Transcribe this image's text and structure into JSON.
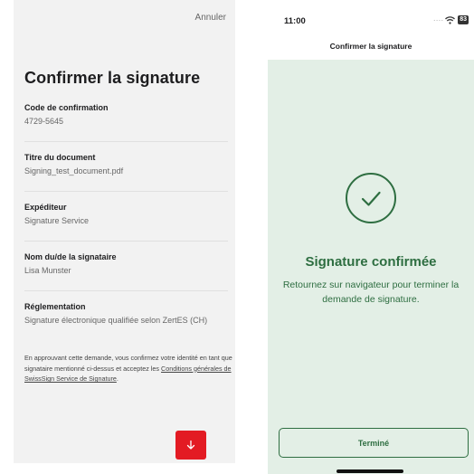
{
  "left": {
    "cancel_label": "Annuler",
    "title": "Confirmer la signature",
    "fields": [
      {
        "label": "Code de confirmation",
        "value": "4729-5645"
      },
      {
        "label": "Titre du document",
        "value": "Signing_test_document.pdf"
      },
      {
        "label": "Expéditeur",
        "value": "Signature Service"
      },
      {
        "label": "Nom du/de la signataire",
        "value": "Lisa Munster"
      },
      {
        "label": "Réglementation",
        "value": "Signature électronique qualifiée selon ZertES (CH)"
      }
    ],
    "consent_text": "En approuvant cette demande, vous confirmez votre identité en tant que signataire mentionné ci-dessus et acceptez les ",
    "consent_link": "Conditions générales de SwissSign Service de Signature",
    "consent_end": ".",
    "next_button_icon": "arrow-down-icon",
    "accent_color": "#e31b23"
  },
  "right": {
    "time": "11:00",
    "battery": "83",
    "nav_title": "Confirmer la signature",
    "success_title": "Signature confirmée",
    "success_message": "Retournez sur navigateur pour terminer la demande de signature.",
    "done_label": "Terminé",
    "success_color": "#2e6e41",
    "background_color": "#e3efe6"
  }
}
